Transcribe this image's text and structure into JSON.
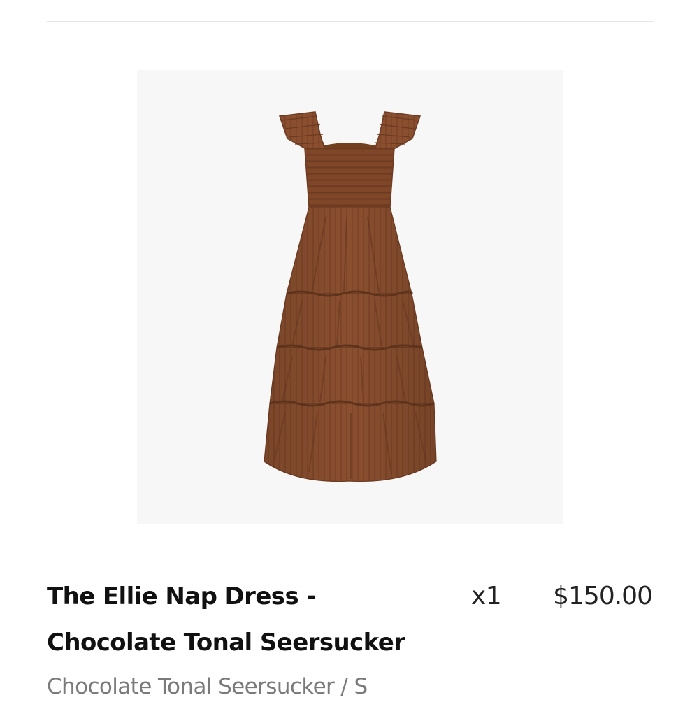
{
  "line_item": {
    "image_alt": "The Ellie Nap Dress - Chocolate Tonal Seersucker",
    "title": "The Ellie Nap Dress - Chocolate Tonal Seersucker",
    "quantity": "x1",
    "price": "$150.00",
    "variant": "Chocolate Tonal Seersucker / S"
  },
  "colors": {
    "divider": "#e6e6e6",
    "image_background": "#f7f7f7",
    "dress": "#8a4f2f",
    "variant_text": "#7a7a7a"
  }
}
